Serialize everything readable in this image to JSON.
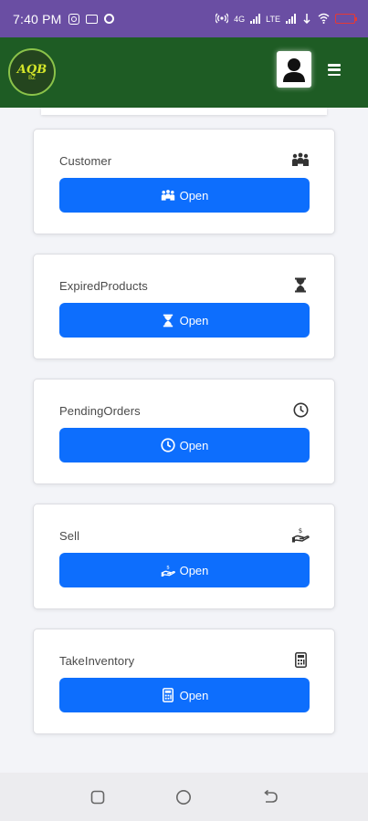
{
  "status_bar": {
    "time": "7:40 PM",
    "network_labels": [
      "4G",
      "LTE"
    ]
  },
  "app_bar": {
    "logo_text": "AQB",
    "logo_subtext": "BZ",
    "accent_color": "#1e5c24"
  },
  "cards": [
    {
      "title": "Customer",
      "icon": "customers-icon",
      "button_label": "Open"
    },
    {
      "title": "ExpiredProducts",
      "icon": "hourglass-icon",
      "button_label": "Open"
    },
    {
      "title": "PendingOrders",
      "icon": "clock-icon",
      "button_label": "Open"
    },
    {
      "title": "Sell",
      "icon": "hand-money-icon",
      "button_label": "Open"
    },
    {
      "title": "TakeInventory",
      "icon": "calculator-icon",
      "button_label": "Open"
    }
  ],
  "colors": {
    "status_bar": "#6a4ea3",
    "button": "#0d6efd",
    "background": "#f3f4f8"
  }
}
